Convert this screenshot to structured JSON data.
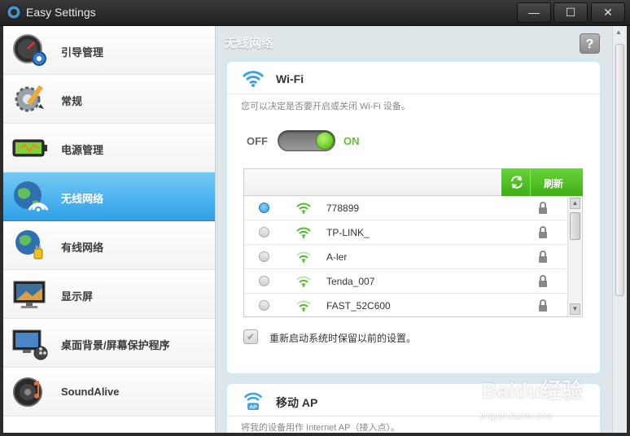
{
  "window": {
    "title": "Easy Settings",
    "minimize": "—",
    "maximize": "☐",
    "close": "✕"
  },
  "sidebar": {
    "items": [
      {
        "label": "引导管理",
        "icon": "gauge-gear-icon"
      },
      {
        "label": "常规",
        "icon": "gear-pencil-icon"
      },
      {
        "label": "电源管理",
        "icon": "battery-icon"
      },
      {
        "label": "无线网络",
        "icon": "globe-wifi-icon"
      },
      {
        "label": "有线网络",
        "icon": "globe-plug-icon"
      },
      {
        "label": "显示屏",
        "icon": "monitor-icon"
      },
      {
        "label": "桌面背景/屏幕保护程序",
        "icon": "desktop-film-icon"
      },
      {
        "label": "SoundAlive",
        "icon": "speaker-icon"
      }
    ],
    "active_index": 3
  },
  "main": {
    "section_title": "无线网络",
    "help": "?",
    "wifi_card": {
      "title": "Wi-Fi",
      "description": "您可以决定是否要开启或关闭 Wi-Fi 设备。",
      "off_label": "OFF",
      "on_label": "ON",
      "toggle_state": "on",
      "refresh_label": "刷新",
      "networks": [
        {
          "name": "778899",
          "selected": true
        },
        {
          "name": "TP-LINK_",
          "selected": false
        },
        {
          "name": "A-ler",
          "selected": false
        },
        {
          "name": "Tenda_007",
          "selected": false
        },
        {
          "name": "FAST_52C600",
          "selected": false
        }
      ],
      "remember_label": "重新启动系统时保留以前的设置。",
      "remember_checked": true
    },
    "ap_card": {
      "title": "移动 AP",
      "icon_text": "AP",
      "description": "将我的设备用作 Internet AP（接入点）。"
    }
  },
  "watermark": {
    "text": "Baidu经验",
    "sub": "jingyan.baidu.com"
  },
  "colors": {
    "accent_blue": "#2ea0e6",
    "accent_green": "#5cc52a"
  }
}
